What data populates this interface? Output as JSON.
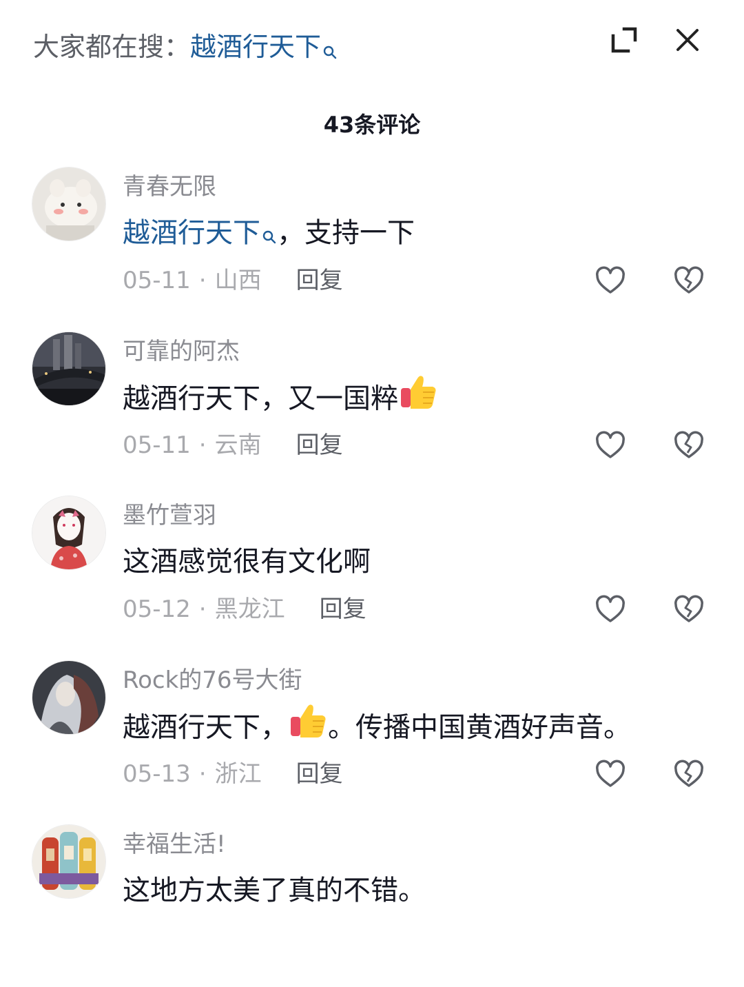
{
  "header": {
    "search_prefix": "大家都在搜：",
    "search_keyword": "越酒行天下",
    "expand_icon": "expand-icon",
    "close_icon": "close-icon"
  },
  "comment_count_title": "43条评论",
  "colors": {
    "keyword_link": "#1f5c97",
    "text_primary": "#161823",
    "text_secondary": "#8a8b91",
    "meta": "#a8a9ad"
  },
  "comments": [
    {
      "username": "青春无限",
      "keyword": "越酒行天下",
      "text_after": "，支持一下",
      "date": "05-11",
      "region": "山西",
      "reply_label": "回复"
    },
    {
      "username": "可靠的阿杰",
      "text": "越酒行天下，又一国粹",
      "date": "05-11",
      "region": "云南",
      "reply_label": "回复"
    },
    {
      "username": "墨竹萱羽",
      "text": "这酒感觉很有文化啊",
      "date": "05-12",
      "region": "黑龙江",
      "reply_label": "回复"
    },
    {
      "username": "Rock的76号大街",
      "text_before": "越酒行天下，",
      "text_after": "。传播中国黄酒好声音。",
      "date": "05-13",
      "region": "浙江",
      "reply_label": "回复"
    },
    {
      "username": "幸福生活!",
      "text": "这地方太美了真的不错。"
    }
  ]
}
